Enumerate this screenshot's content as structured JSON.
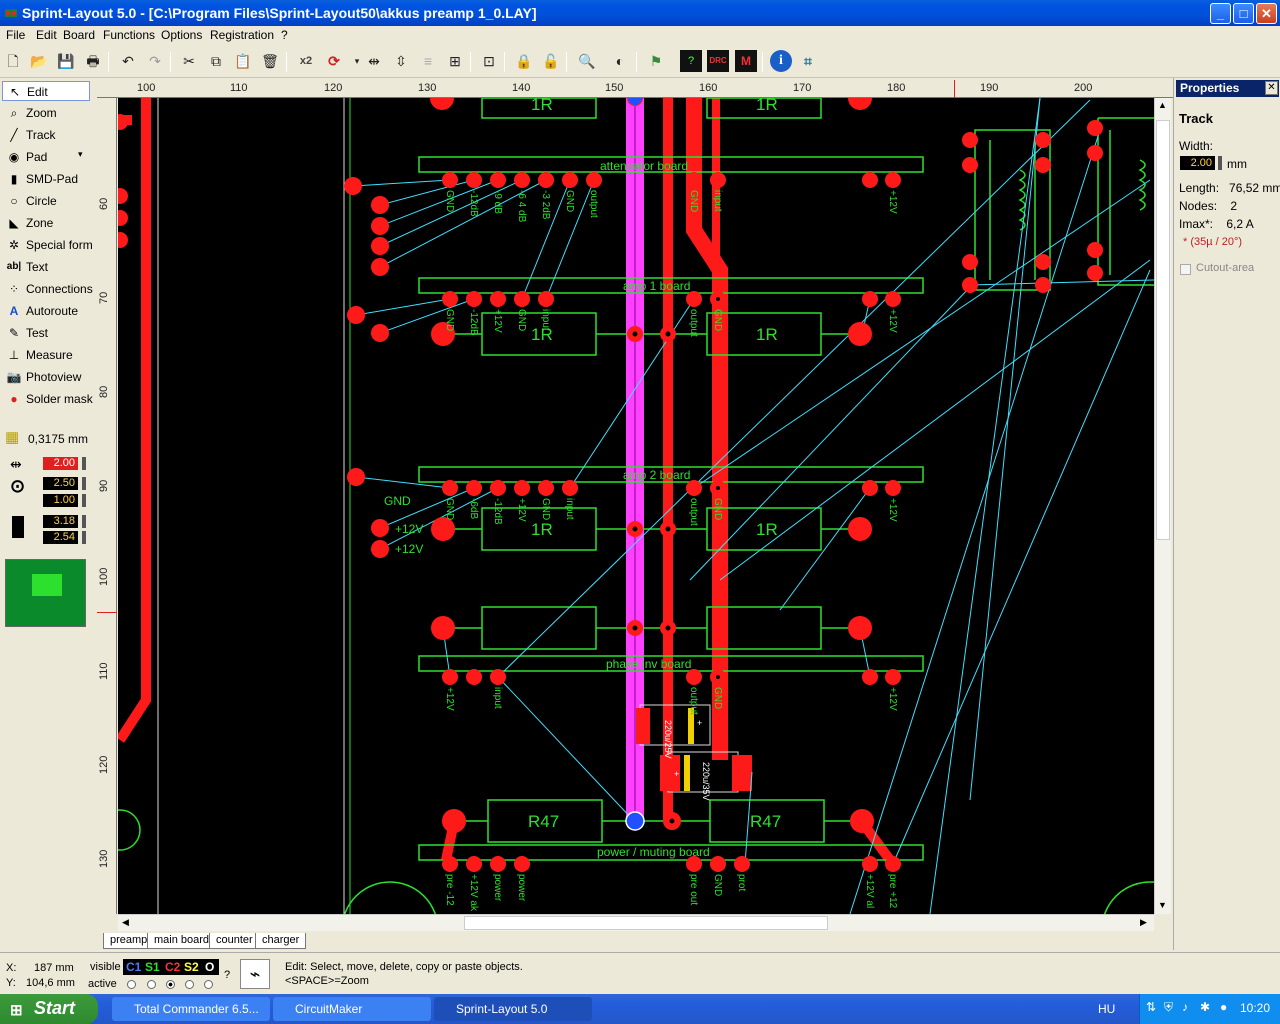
{
  "window": {
    "title": "Sprint-Layout 5.0 - [C:\\Program Files\\Sprint-Layout50\\akkus preamp 1_0.LAY]",
    "controls": [
      "_",
      "□",
      "✕"
    ]
  },
  "menu": [
    "File",
    "Edit",
    "Board",
    "Functions",
    "Options",
    "Registration",
    "?"
  ],
  "toolbar": {
    "icons": [
      "new-icon",
      "open-icon",
      "save-icon",
      "print-icon",
      "undo-icon",
      "redo-icon",
      "cut-icon",
      "copy-icon",
      "paste-icon",
      "delete-icon",
      "x2-icon",
      "rotate-icon",
      "mirror-h-icon",
      "mirror-v-icon",
      "align-icon",
      "group-icon",
      "ungroup-icon",
      "lock-icon",
      "unlock-icon",
      "zoom-icon",
      "contrast-icon",
      "checker-icon",
      "drc-icon",
      "macro-icon",
      "info-icon",
      "select-icon"
    ],
    "x2_label": "x2",
    "drc_label": "DRC",
    "macro_label": "M"
  },
  "tools": [
    {
      "label": "Edit",
      "icon": "arrow-icon"
    },
    {
      "label": "Zoom",
      "icon": "magnifier-icon"
    },
    {
      "label": "Track",
      "icon": "track-icon"
    },
    {
      "label": "Pad",
      "icon": "pad-icon"
    },
    {
      "label": "SMD-Pad",
      "icon": "smd-pad-icon"
    },
    {
      "label": "Circle",
      "icon": "circle-icon"
    },
    {
      "label": "Zone",
      "icon": "zone-icon"
    },
    {
      "label": "Special form",
      "icon": "special-form-icon"
    },
    {
      "label": "Text",
      "icon": "text-icon"
    },
    {
      "label": "Connections",
      "icon": "connections-icon"
    },
    {
      "label": "Autoroute",
      "icon": "autoroute-icon"
    },
    {
      "label": "Test",
      "icon": "test-icon"
    },
    {
      "label": "Measure",
      "icon": "measure-icon"
    },
    {
      "label": "Photoview",
      "icon": "photoview-icon"
    },
    {
      "label": "Solder mask",
      "icon": "solder-mask-icon"
    }
  ],
  "settings": {
    "grid": "0,3175 mm",
    "track_width": "2.00",
    "pad_outer": "2.50",
    "pad_inner": "1.00",
    "smd_width": "3.18",
    "smd_height": "2.54"
  },
  "ruler": {
    "h": [
      "100",
      "110",
      "120",
      "130",
      "140",
      "150",
      "160",
      "170",
      "180",
      "190",
      "200"
    ],
    "v": [
      "60",
      "70",
      "80",
      "90",
      "100",
      "110",
      "120",
      "130"
    ]
  },
  "pcb": {
    "boards": [
      "attenuator board",
      "amp 1 board",
      "amp 2 board",
      "phase inv board",
      "power / muting board"
    ],
    "components": [
      "1R",
      "1R",
      "1R",
      "1R",
      "1R",
      "1R",
      "R47",
      "R47"
    ],
    "pin_labels_att": [
      "GND",
      "-12dB",
      "-9 dB",
      "-6 4 dB",
      "-3 2dB",
      "GND",
      "output"
    ],
    "pin_labels_att2": [
      "GND",
      "input",
      "+12V"
    ],
    "pin_labels_amp1": [
      "GND",
      "-12dB",
      "+12V",
      "GND",
      "input"
    ],
    "pin_labels_amp1b": [
      "output",
      "GND",
      "+12V"
    ],
    "pin_labels_amp2": [
      "GND",
      "-6dB",
      "-12dB",
      "+12V",
      "GND",
      "input"
    ],
    "pin_labels_amp2b": [
      "output",
      "GND",
      "+12V"
    ],
    "gnd_label": "GND",
    "v12_label_a": "+12V",
    "v12_label_b": "+12V",
    "pin_labels_phase": [
      "+12V",
      "input",
      "output",
      "GND",
      "+12V"
    ],
    "pin_labels_power": [
      "pre -12",
      "+12V ak",
      "power",
      "power",
      "pre out",
      "GND",
      "prot",
      "+12V al",
      "pre +12"
    ],
    "cap_label": "+",
    "cap_value1": "220u/25V",
    "cap_value2": "220u/35V"
  },
  "properties": {
    "title": "Properties",
    "object": "Track",
    "width_label": "Width:",
    "width_value": "2.00",
    "width_unit": "mm",
    "length": "Length:   76,52 mm",
    "nodes": "Nodes:    2",
    "imax": "Imax*:    6,2 A",
    "note": "* (35µ / 20°)",
    "cutout": "Cutout-area"
  },
  "sheets": [
    "preamp",
    "main board",
    "counter",
    "charger"
  ],
  "status": {
    "x_label": "X:",
    "x_value": "187 mm",
    "y_label": "Y:",
    "y_value": "104,6 mm",
    "visible_label": "visible",
    "active_label": "active",
    "layers": [
      "C1",
      "S1",
      "C2",
      "S2",
      "O"
    ],
    "help_q": "?",
    "hint1": "Edit: Select, move, delete, copy or paste objects.",
    "hint2": "<SPACE>=Zoom"
  },
  "taskbar": {
    "start": "Start",
    "tasks": [
      "Total Commander 6.5...",
      "CircuitMaker",
      "Sprint-Layout 5.0"
    ],
    "lang": "HU",
    "clock": "10:20"
  }
}
